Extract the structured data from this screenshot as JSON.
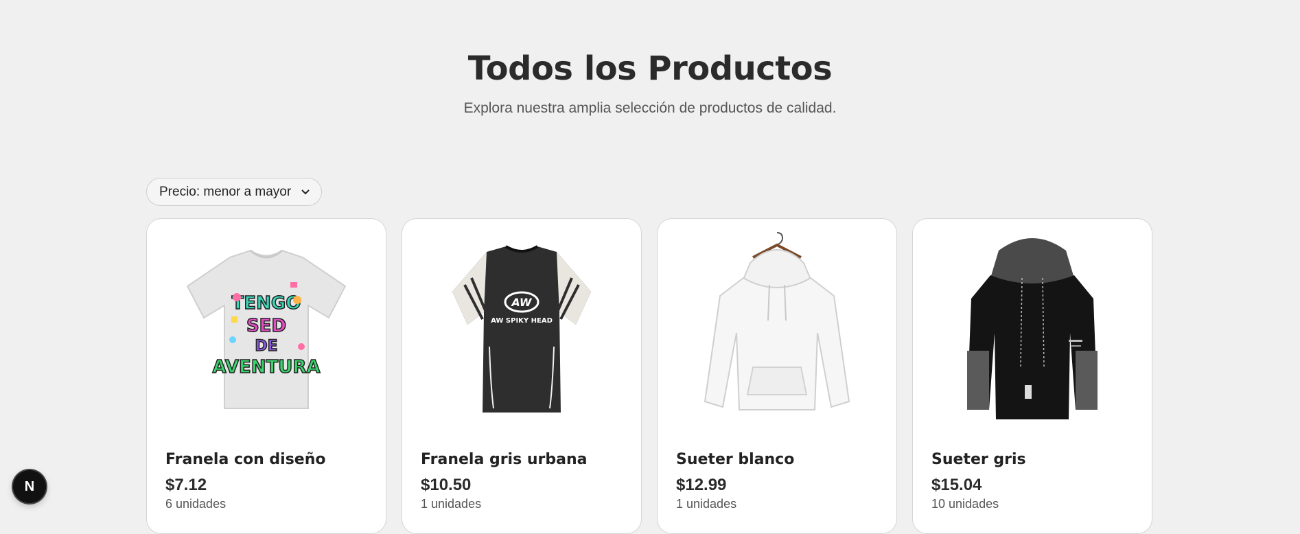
{
  "header": {
    "title": "Todos los Productos",
    "subtitle": "Explora nuestra amplia selección de productos de calidad."
  },
  "sort": {
    "selected": "Precio: menor a mayor"
  },
  "products": [
    {
      "name": "Franela con diseño",
      "price": "$7.12",
      "stock": "6 unidades",
      "image": "white-tshirt-graphic",
      "graphic_text": "TENGO SED DE AVENTURA"
    },
    {
      "name": "Franela gris urbana",
      "price": "$10.50",
      "stock": "1 unidades",
      "image": "black-sport-tshirt",
      "graphic_text": "AW",
      "graphic_subtext": "AW SPIKY HEAD"
    },
    {
      "name": "Sueter blanco",
      "price": "$12.99",
      "stock": "1 unidades",
      "image": "white-hoodie"
    },
    {
      "name": "Sueter gris",
      "price": "$15.04",
      "stock": "10 unidades",
      "image": "black-hoodie"
    }
  ],
  "badge": {
    "letter": "N"
  },
  "colors": {
    "background": "#f0f0f0",
    "card": "#ffffff",
    "text": "#2b2b2b",
    "badge": "#111111"
  }
}
